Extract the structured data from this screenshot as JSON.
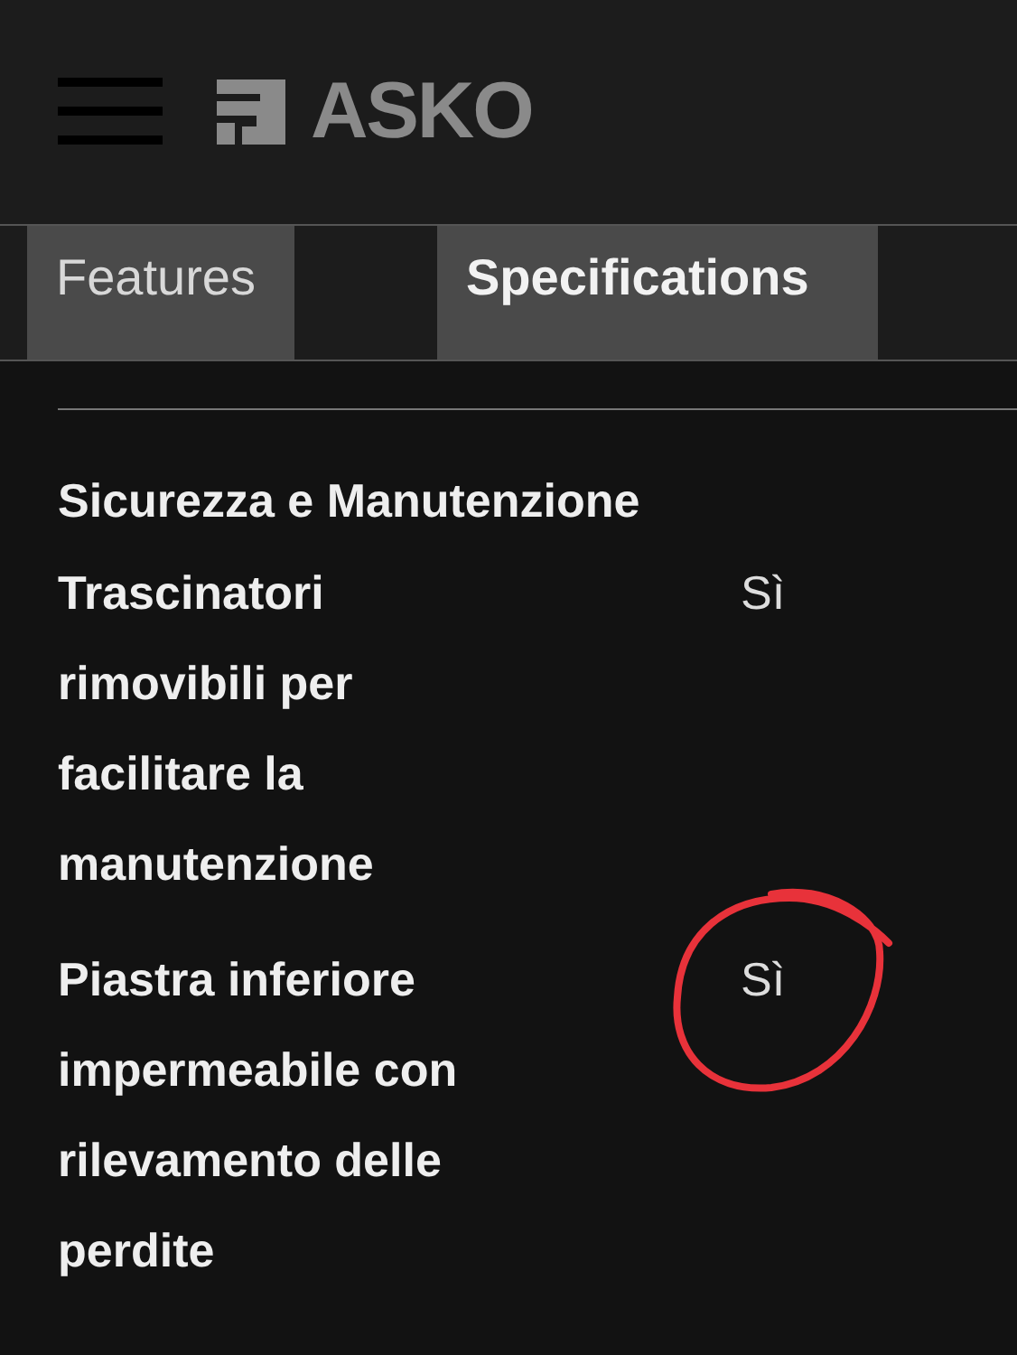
{
  "header": {
    "logo_text": "ASKO"
  },
  "tabs": [
    {
      "label": "Features",
      "selected": false
    },
    {
      "label": "Specifications",
      "selected": true
    }
  ],
  "section": {
    "title": "Sicurezza e Manutenzione",
    "rows": [
      {
        "label": "Trascinatori rimovibili per facilitare la manutenzione",
        "value": "Sì",
        "circled": false
      },
      {
        "label": "Piastra inferiore impermeabile con rilevamento delle perdite",
        "value": "Sì",
        "circled": true
      }
    ]
  }
}
